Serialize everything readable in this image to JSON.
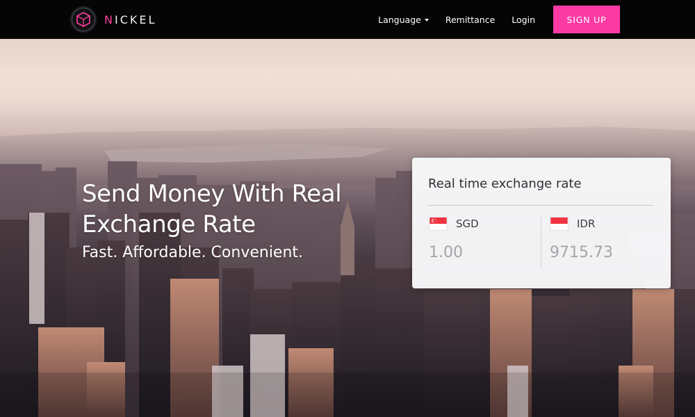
{
  "brand": {
    "name_accent": "N",
    "name_rest": "ICKEL",
    "accent_color": "#fc3aa4",
    "logo_icon": "hexagon-cube-icon"
  },
  "nav": {
    "language_label": "Language",
    "remittance_label": "Remittance",
    "login_label": "Login",
    "signup_label": "SIGN UP"
  },
  "hero": {
    "title": "Send Money With Real Exchange Rate",
    "subtitle": "Fast. Affordable. Convenient."
  },
  "exchange": {
    "title": "Real time exchange rate",
    "from": {
      "code": "SGD",
      "amount": "1.00",
      "flag_icon": "singapore-flag-icon"
    },
    "to": {
      "code": "IDR",
      "amount": "9715.73",
      "flag_icon": "indonesia-flag-icon"
    }
  }
}
